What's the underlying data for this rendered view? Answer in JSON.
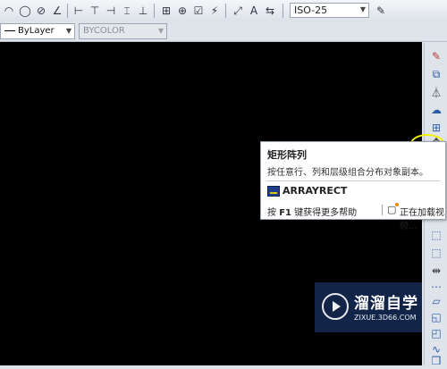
{
  "toolbar": {
    "dimension_style": "ISO-25",
    "icons": [
      "arc-icon",
      "circle-icon",
      "ellipse-icon",
      "angle-icon",
      "dim-linear-icon",
      "dim-baseline-icon",
      "dim-continue-icon",
      "dim-break-icon",
      "dim-space-icon",
      "tolerance-icon",
      "center-mark-icon",
      "inspect-icon",
      "jogged-icon",
      "dim-edit-icon",
      "dim-text-edit-icon",
      "dim-update-icon",
      "dim-style-brush-icon"
    ]
  },
  "properties": {
    "linetype": "ByLayer",
    "color": "BYCOLOR"
  },
  "right_toolbar": {
    "icons": [
      "erase-icon",
      "copy-icon",
      "mirror-icon",
      "offset-icon",
      "array-rect-icon",
      "move-icon",
      "rotate-icon",
      "scale-icon",
      "stretch-icon",
      "trim-icon",
      "extend-icon",
      "break-icon",
      "join-icon",
      "chamfer-icon",
      "fillet-icon",
      "blend-icon",
      "explode-icon"
    ]
  },
  "tooltip": {
    "title": "矩形阵列",
    "description": "按任意行、列和层级组合分布对象副本。",
    "command": "ARRAYRECT",
    "help_prefix": "按",
    "help_key": "F1",
    "help_suffix": "键获得更多帮助",
    "video_status": "正在加载视频..."
  },
  "watermark": {
    "title": "溜溜自学",
    "url": "ZIXUE.3D66.COM"
  },
  "colors": {
    "canvas": "#000000",
    "annotation_arrow": "#e8322c",
    "highlight": "#f2f200"
  }
}
